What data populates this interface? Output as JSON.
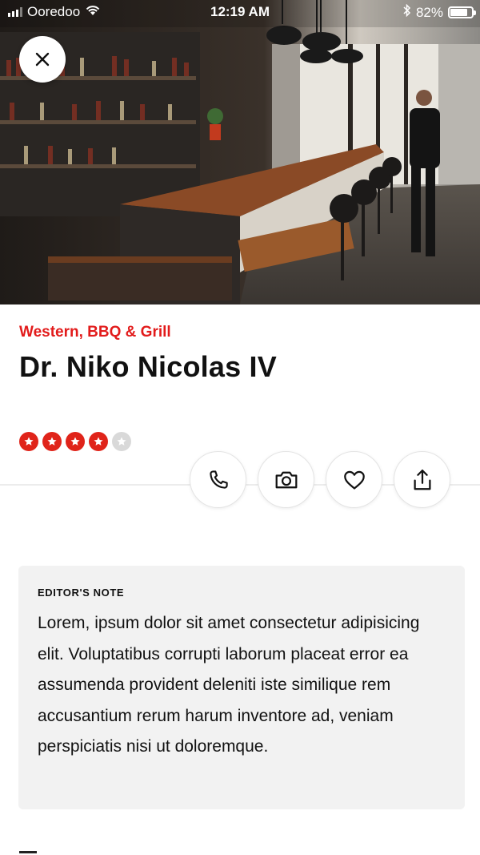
{
  "status_bar": {
    "carrier": "Ooredoo",
    "time": "12:19 AM",
    "battery": "82%",
    "battery_level": 0.82,
    "icons": [
      "signal-icon",
      "wifi-icon",
      "bluetooth-icon",
      "battery-icon"
    ]
  },
  "hero": {
    "close_icon": "close-icon"
  },
  "restaurant": {
    "category": "Western, BBQ & Grill",
    "name": "Dr. Niko Nicolas IV",
    "rating": 4,
    "rating_max": 5
  },
  "actions": [
    {
      "name": "call",
      "icon": "phone-icon"
    },
    {
      "name": "photo",
      "icon": "camera-icon"
    },
    {
      "name": "favorite",
      "icon": "heart-icon"
    },
    {
      "name": "share",
      "icon": "share-icon"
    }
  ],
  "editors_note": {
    "label": "EDITOR'S NOTE",
    "text": "Lorem, ipsum dolor sit amet consectetur adipisicing elit. Voluptatibus corrupti laborum placeat error ea assumenda provident deleniti iste similique rem accusantium rerum harum inventore ad, veniam perspiciatis nisi ut doloremque."
  },
  "colors": {
    "accent": "#e21b1b",
    "star_on": "#e0241a",
    "star_off": "#d9d9d9",
    "note_bg": "#f2f2f2"
  }
}
